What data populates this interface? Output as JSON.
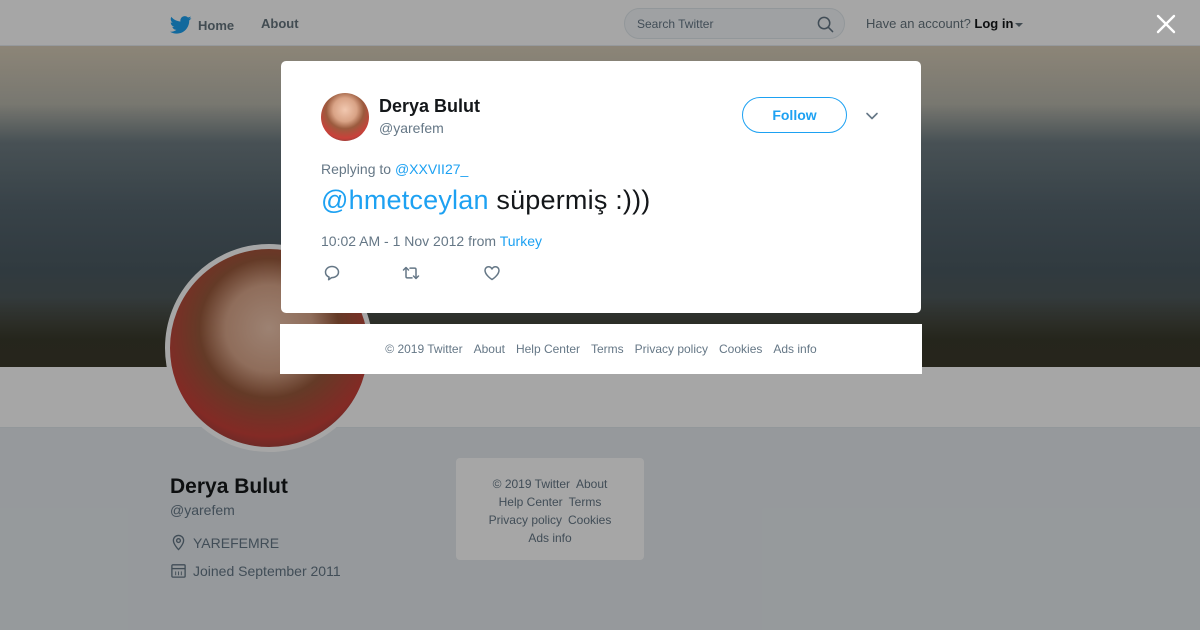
{
  "topnav": {
    "home_label": "Home",
    "about_label": "About",
    "search_placeholder": "Search Twitter",
    "account_prompt": "Have an account?",
    "login_label": "Log in"
  },
  "profile": {
    "name": "Derya Bulut",
    "handle": "@yarefem",
    "location": "YAREFEMRE",
    "joined": "Joined September 2011"
  },
  "side_footer": {
    "copyright": "© 2019 Twitter",
    "about": "About",
    "help_center": "Help Center",
    "terms": "Terms",
    "privacy": "Privacy policy",
    "cookies": "Cookies",
    "ads_info": "Ads info"
  },
  "tweet": {
    "author_name": "Derya Bulut",
    "author_handle": "@yarefem",
    "follow_label": "Follow",
    "replying_prefix": "Replying to",
    "replying_to": "@XXVII27_",
    "mention": "@hmetceylan",
    "text": " süpermiş :)))",
    "timestamp": "10:02 AM - 1 Nov 2012",
    "from_label": "from",
    "place": "Turkey"
  },
  "modal_footer": {
    "copyright": "© 2019 Twitter",
    "about": "About",
    "help_center": "Help Center",
    "terms": "Terms",
    "privacy": "Privacy policy",
    "cookies": "Cookies",
    "ads_info": "Ads info"
  },
  "colors": {
    "accent": "#1da1f2",
    "muted_text": "#657786",
    "background": "#e6ecf0"
  },
  "icons": [
    "twitter-bird-icon",
    "search-icon",
    "close-icon",
    "chevron-down-icon",
    "location-pin-icon",
    "calendar-icon",
    "reply-icon",
    "retweet-icon",
    "like-icon"
  ]
}
